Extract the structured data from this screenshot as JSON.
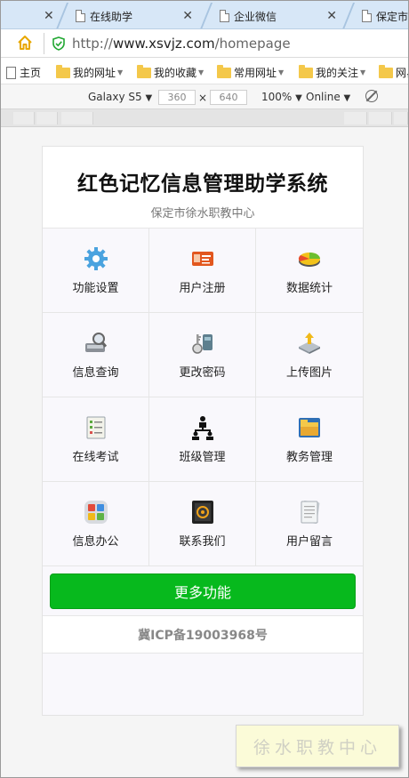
{
  "browser": {
    "tabs": [
      {
        "label": "在线助学"
      },
      {
        "label": "企业微信"
      },
      {
        "label": "保定市"
      }
    ],
    "url_domain": "www.xsvjz.com",
    "url_prefix": "http://",
    "url_path": "/homepage",
    "bookmarks": [
      {
        "label": "主页",
        "icon": "page-icon"
      },
      {
        "label": "我的网址",
        "icon": "folder-icon"
      },
      {
        "label": "我的收藏",
        "icon": "folder-icon"
      },
      {
        "label": "常用网址",
        "icon": "folder-icon"
      },
      {
        "label": "我的关注",
        "icon": "folder-icon"
      },
      {
        "label": "网易",
        "icon": "folder-icon"
      }
    ],
    "device": {
      "model": "Galaxy S5",
      "width": "360",
      "height": "640",
      "times": "×",
      "zoom": "100%",
      "network": "Online"
    }
  },
  "app": {
    "title": "红色记忆信息管理助学系统",
    "subtitle": "保定市徐水职教中心",
    "menu": [
      {
        "label": "功能设置",
        "icon": "gear-icon"
      },
      {
        "label": "用户注册",
        "icon": "id-card-icon"
      },
      {
        "label": "数据统计",
        "icon": "chart-icon"
      },
      {
        "label": "信息查询",
        "icon": "search-drive-icon"
      },
      {
        "label": "更改密码",
        "icon": "key-icon"
      },
      {
        "label": "上传图片",
        "icon": "upload-icon"
      },
      {
        "label": "在线考试",
        "icon": "checklist-icon"
      },
      {
        "label": "班级管理",
        "icon": "team-icon"
      },
      {
        "label": "教务管理",
        "icon": "folder-window-icon"
      },
      {
        "label": "信息办公",
        "icon": "office-icon"
      },
      {
        "label": "联系我们",
        "icon": "contact-icon"
      },
      {
        "label": "用户留言",
        "icon": "notepad-icon"
      }
    ],
    "more_label": "更多功能",
    "icp": "冀ICP备19003968号",
    "watermark": "徐水职教中心"
  }
}
